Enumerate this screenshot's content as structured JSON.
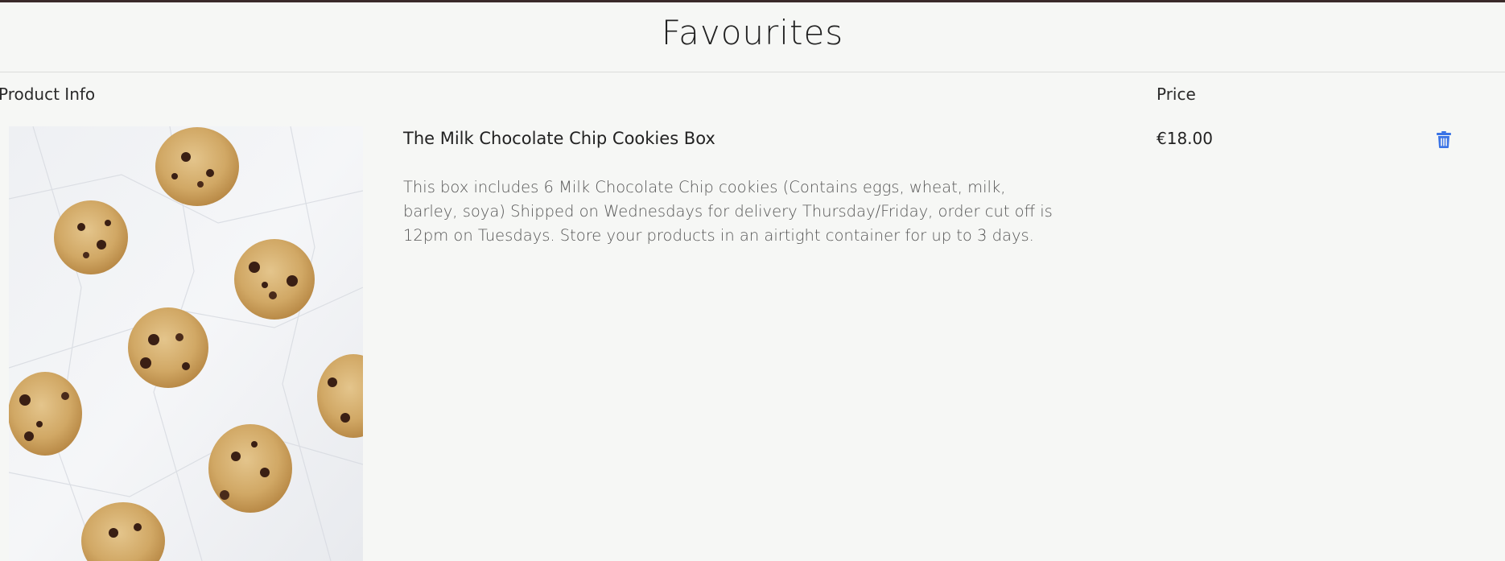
{
  "page": {
    "title": "Favourites"
  },
  "table": {
    "headers": {
      "product_info": "Product Info",
      "price": "Price"
    }
  },
  "items": [
    {
      "name": "The Milk Chocolate Chip Cookies Box",
      "description": "This box includes 6 Milk Chocolate Chip cookies (Contains eggs, wheat, milk, barley, soya) Shipped on Wednesdays for delivery Thursday/Friday, order cut off is 12pm on Tuesdays. Store your products in an airtight container for up to 3 days.",
      "price": "€18.00",
      "image_icon": "cookies-photo",
      "delete_icon": "trash-icon"
    }
  ],
  "colors": {
    "background": "#f6f7f5",
    "top_border": "#3a2a2a",
    "delete_icon": "#3b74e6"
  }
}
